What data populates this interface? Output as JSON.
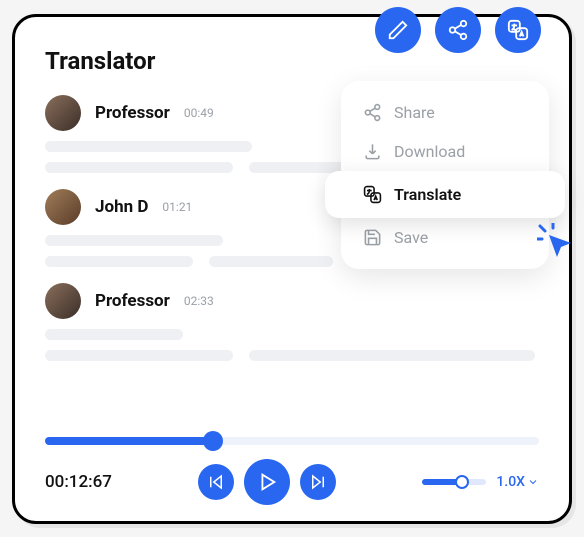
{
  "title": "Translator",
  "colors": {
    "accent": "#2967f0"
  },
  "header_actions": [
    "edit",
    "share",
    "translate"
  ],
  "segments": [
    {
      "speaker": "Professor",
      "timestamp": "00:49",
      "avatarVariant": "default",
      "lines": [
        [
          42
        ],
        [
          38,
          58
        ]
      ]
    },
    {
      "speaker": "John D",
      "timestamp": "01:21",
      "avatarVariant": "alt",
      "lines": [
        [
          36
        ],
        [
          30,
          25
        ]
      ]
    },
    {
      "speaker": "Professor",
      "timestamp": "02:33",
      "avatarVariant": "default",
      "lines": [
        [
          28
        ],
        [
          38,
          58
        ]
      ]
    }
  ],
  "menu": {
    "items": [
      {
        "icon": "share-icon",
        "label": "Share",
        "active": false
      },
      {
        "icon": "download-icon",
        "label": "Download",
        "active": false
      },
      {
        "icon": "translate-icon",
        "label": "Translate",
        "active": true
      },
      {
        "icon": "save-icon",
        "label": "Save",
        "active": false
      }
    ]
  },
  "player": {
    "position_pct": 34,
    "current_time": "00:12:67",
    "speed_label": "1.0X",
    "speed_pct": 62
  }
}
